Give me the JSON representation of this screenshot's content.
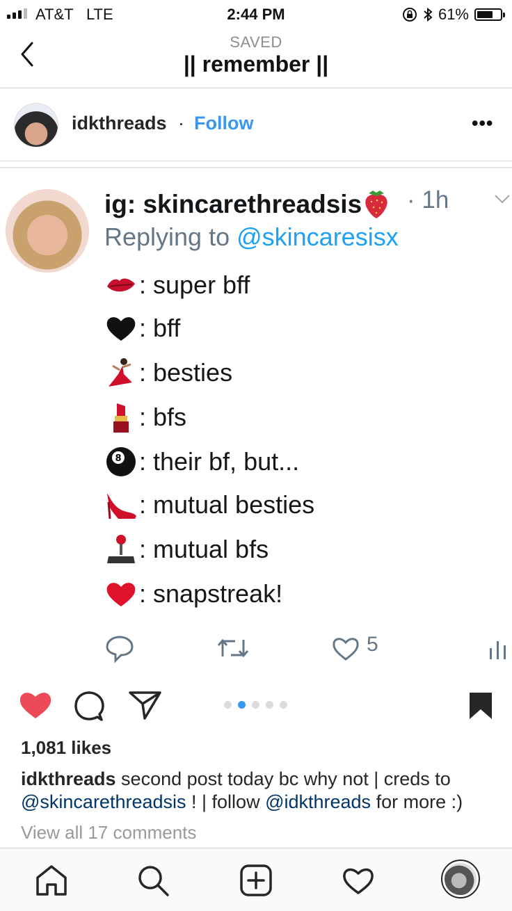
{
  "status_bar": {
    "carrier": "AT&T",
    "network": "LTE",
    "time": "2:44 PM",
    "battery": "61%"
  },
  "header": {
    "saved_label": "SAVED",
    "title": "|| remember ||"
  },
  "post": {
    "username": "idkthreads",
    "separator": "·",
    "follow_label": "Follow",
    "more_label": "•••"
  },
  "tweet": {
    "name": "ig: skincarethreadsis",
    "time": "· 1h",
    "replying_prefix": "Replying to ",
    "replying_handle": "@skincaresisx",
    "lines": [
      {
        "emoji": "kiss-mark",
        "text": ": super bff"
      },
      {
        "emoji": "black-heart",
        "text": ": bff"
      },
      {
        "emoji": "dancer",
        "text": ": besties"
      },
      {
        "emoji": "lipstick",
        "text": ": bfs"
      },
      {
        "emoji": "8-ball",
        "text": ": their bf, but..."
      },
      {
        "emoji": "high-heel",
        "text": ": mutual besties"
      },
      {
        "emoji": "joystick",
        "text": ": mutual bfs"
      },
      {
        "emoji": "red-heart",
        "text": ": snapstreak!"
      }
    ],
    "like_count": "5"
  },
  "actions": {
    "likes": "1,081 likes",
    "caption_user": "idkthreads",
    "caption_part1": " second post today bc why not | creds to ",
    "caption_mention1": "@skincarethreadsis",
    "caption_part2": " ! | follow ",
    "caption_mention2": "@idkthreads",
    "caption_part3": " for more :)",
    "view_comments": "View all 17 comments",
    "carousel_active_index": 2,
    "carousel_count": 5
  },
  "colors": {
    "ig_blue": "#3897f0",
    "twitter_blue": "#1da1f2",
    "like_red": "#ed4956",
    "muted": "#657786"
  }
}
